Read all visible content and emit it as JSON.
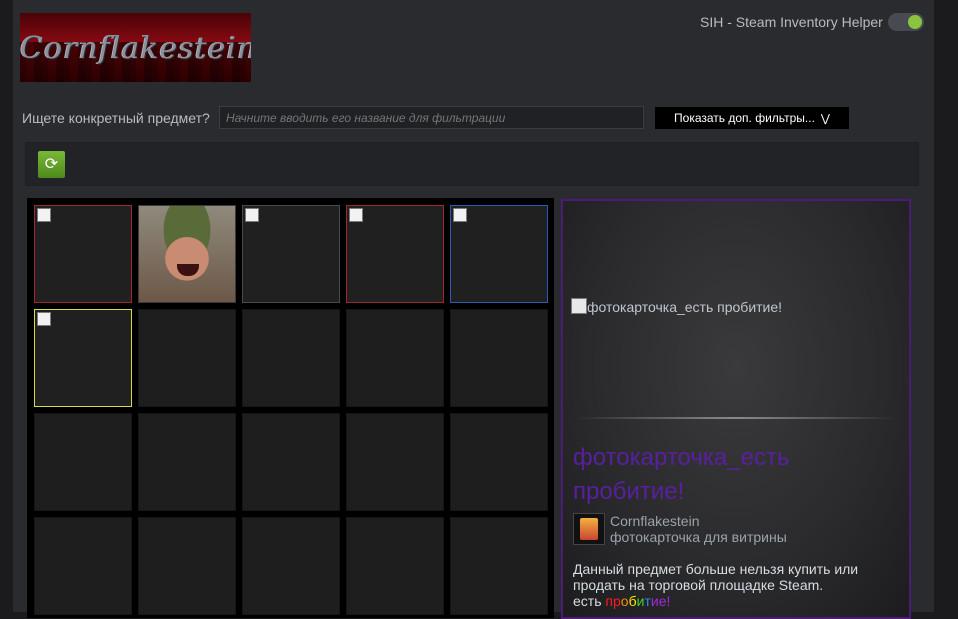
{
  "profile": {
    "logo_text": "Cornflakestein"
  },
  "extension": {
    "label": "SIH - Steam Inventory Helper",
    "enabled": true,
    "toggle_color": "#8bc43f"
  },
  "filter": {
    "label": "Ищете конкретный предмет?",
    "placeholder": "Начните вводить его название для фильтрации",
    "more_button": "Показать доп. фильтры..."
  },
  "inventory": {
    "slots": [
      {
        "kind": "broken",
        "border": "#a1282b"
      },
      {
        "kind": "soldier",
        "border": "#3a3a3a"
      },
      {
        "kind": "broken",
        "border": "#4a4a4a"
      },
      {
        "kind": "broken",
        "border": "#a1282b"
      },
      {
        "kind": "broken",
        "border": "#2a5bb0"
      },
      {
        "kind": "broken",
        "border": "#d8d84a"
      }
    ],
    "visible_rows": 4,
    "columns": 5
  },
  "detail": {
    "image_alt": "фотокарточка_есть пробитие!",
    "title": "фотокарточка_есть пробитие!",
    "title_color": "#5a1fa0",
    "game_name": "Cornflakestein",
    "item_type": "фотокарточка для витрины",
    "description": "Данный предмет больше нельзя купить или продать на торговой площадке Steam.",
    "footer_prefix": "есть ",
    "footer_rainbow": "пробитие!"
  }
}
